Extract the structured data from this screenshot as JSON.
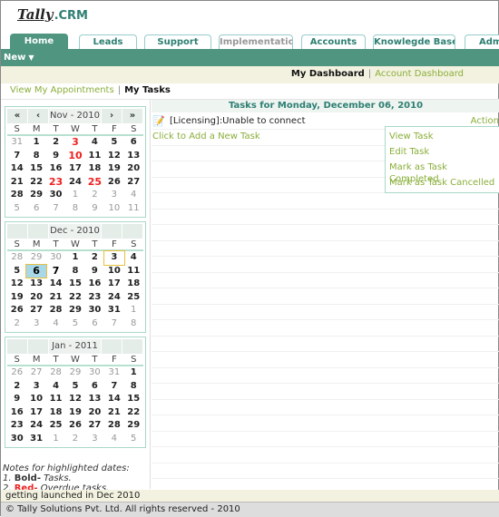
{
  "logo": {
    "brand": "Tally",
    "suffix": ".CRM"
  },
  "tabs": [
    {
      "label": "Home",
      "active": true
    },
    {
      "label": "Leads"
    },
    {
      "label": "Support"
    },
    {
      "label": "Implementation",
      "disabled": true
    },
    {
      "label": "Accounts"
    },
    {
      "label": "Knowlegde Base"
    },
    {
      "label": "Adm"
    }
  ],
  "toolbar": {
    "new_label": "New",
    "new_icon": "caret-down-icon"
  },
  "dashboard": {
    "my": "My Dashboard",
    "account": "Account Dashboard",
    "sep": "|"
  },
  "subnav": {
    "appointments": "View My Appointments",
    "tasks": "My Tasks",
    "sep": "|"
  },
  "calendars": [
    {
      "month": "Nov - 2010",
      "nav": [
        "«",
        "‹",
        "›",
        "»"
      ],
      "dow": [
        "S",
        "M",
        "T",
        "W",
        "T",
        "F",
        "S"
      ],
      "weeks": [
        [
          31,
          1,
          2,
          3,
          4,
          5,
          6
        ],
        [
          7,
          8,
          9,
          10,
          11,
          12,
          13
        ],
        [
          14,
          15,
          16,
          17,
          18,
          19,
          20
        ],
        [
          21,
          22,
          23,
          24,
          25,
          26,
          27
        ],
        [
          28,
          29,
          30,
          1,
          2,
          3,
          4
        ],
        [
          5,
          6,
          7,
          8,
          9,
          10,
          11
        ]
      ],
      "red": [
        3,
        10,
        23,
        25
      ],
      "bold": [],
      "selected": null,
      "today": null
    },
    {
      "month": "Dec - 2010",
      "nav": [
        "",
        "",
        "",
        ""
      ],
      "dow": [
        "S",
        "M",
        "T",
        "W",
        "T",
        "F",
        "S"
      ],
      "weeks": [
        [
          28,
          29,
          30,
          1,
          2,
          3,
          4
        ],
        [
          5,
          6,
          7,
          8,
          9,
          10,
          11
        ],
        [
          12,
          13,
          14,
          15,
          16,
          17,
          18
        ],
        [
          19,
          20,
          21,
          22,
          23,
          24,
          25
        ],
        [
          26,
          27,
          28,
          29,
          30,
          31,
          1
        ],
        [
          2,
          3,
          4,
          5,
          6,
          7,
          8
        ]
      ],
      "red": [],
      "bold": [
        7
      ],
      "selected": 6,
      "today": 3
    },
    {
      "month": "Jan - 2011",
      "nav": [
        "",
        "",
        "",
        ""
      ],
      "dow": [
        "S",
        "M",
        "T",
        "W",
        "T",
        "F",
        "S"
      ],
      "weeks": [
        [
          26,
          27,
          28,
          29,
          30,
          31,
          1
        ],
        [
          2,
          3,
          4,
          5,
          6,
          7,
          8
        ],
        [
          9,
          10,
          11,
          12,
          13,
          14,
          15
        ],
        [
          16,
          17,
          18,
          19,
          20,
          21,
          22
        ],
        [
          23,
          24,
          25,
          26,
          27,
          28,
          29
        ],
        [
          30,
          31,
          1,
          2,
          3,
          4,
          5
        ]
      ],
      "red": [],
      "bold": [],
      "selected": null,
      "today": null
    }
  ],
  "notes": {
    "title": "Notes for highlighted dates:",
    "n1": "1.",
    "bold_label": "Bold-",
    "bold_desc": "Tasks.",
    "n2": "2.",
    "red_label": "Red-",
    "red_desc": "Overdue tasks."
  },
  "tasks": {
    "header": "Tasks for Monday, December 06, 2010",
    "items": [
      {
        "text": "[Licensing]:Unable to connect",
        "icon": "task-edit-icon",
        "action": "Action"
      }
    ],
    "add": "Click to Add a New Task",
    "menu": [
      "View Task",
      "Edit Task",
      "Mark as Task Completed",
      "Mark as Task Cancelled"
    ]
  },
  "ticker": "getting launched in Dec 2010",
  "footer": "© Tally Solutions Pvt. Ltd. All rights reserved - 2010",
  "colors": {
    "accent": "#4f9580",
    "link": "#8aae3a",
    "overdue": "#ee2222"
  }
}
